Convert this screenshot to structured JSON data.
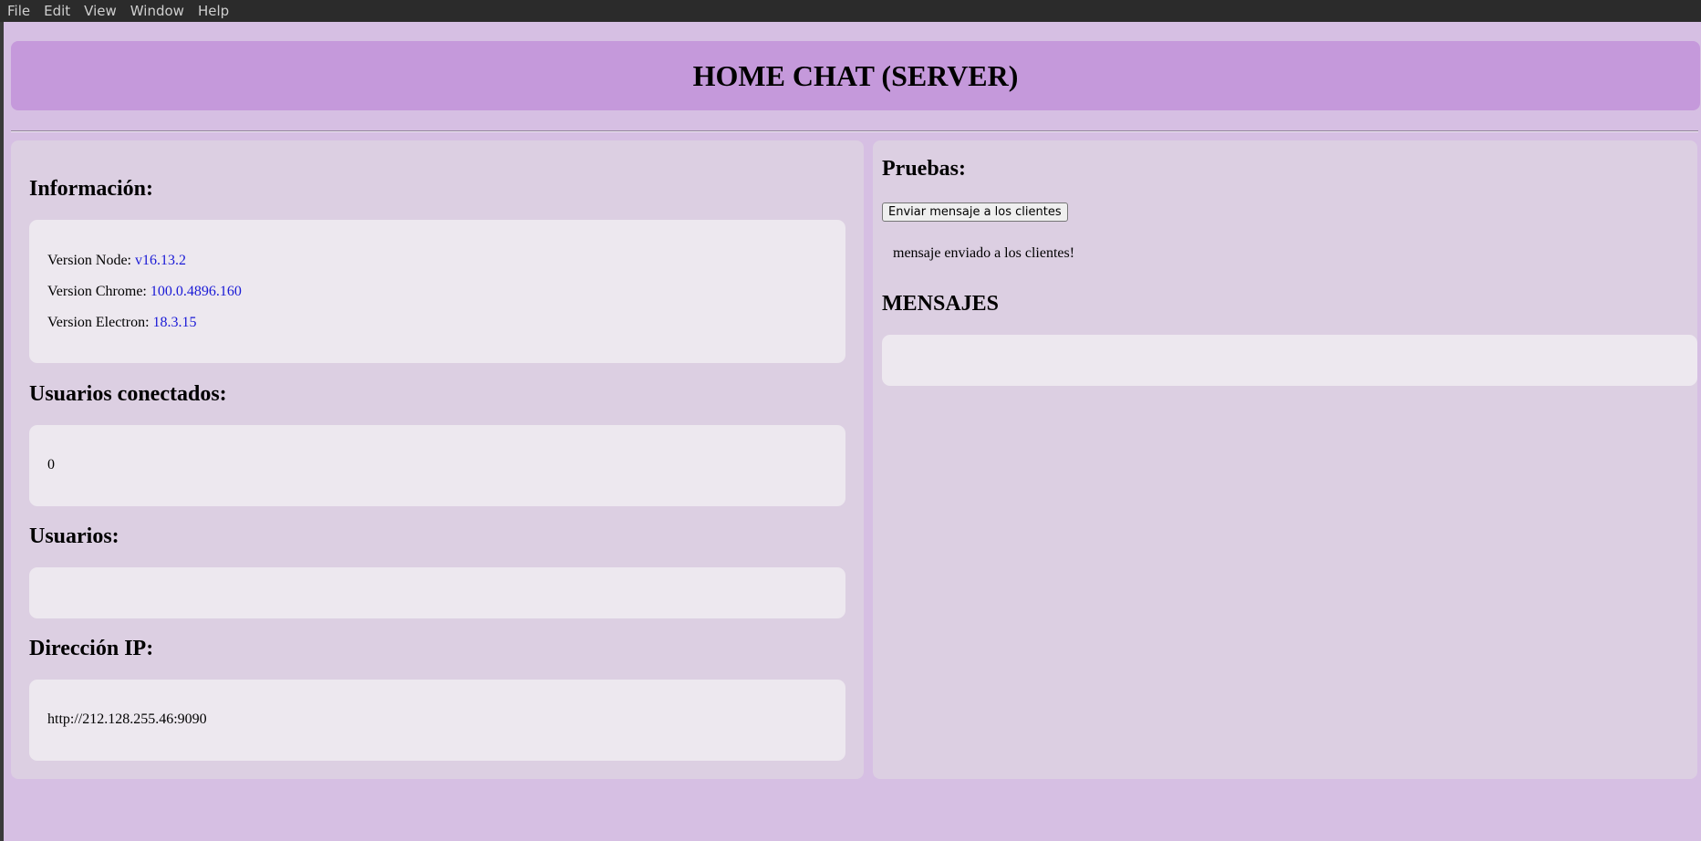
{
  "menu": [
    "File",
    "Edit",
    "View",
    "Window",
    "Help"
  ],
  "header": {
    "title": "HOME CHAT (SERVER)"
  },
  "info": {
    "heading": "Información:",
    "node_label": "Version Node:",
    "node_value": "v16.13.2",
    "chrome_label": "Version Chrome:",
    "chrome_value": "100.0.4896.160",
    "electron_label": "Version Electron:",
    "electron_value": "18.3.15"
  },
  "connected": {
    "heading": "Usuarios conectados:",
    "value": "0"
  },
  "users": {
    "heading": "Usuarios:"
  },
  "ip": {
    "heading": "Dirección IP:",
    "value": "http://212.128.255.46:9090"
  },
  "tests": {
    "heading": "Pruebas:",
    "button_label": "Enviar mensaje a los clientes",
    "status": "mensaje enviado a los clientes!"
  },
  "messages": {
    "heading": "MENSAJES"
  },
  "colors": {
    "background": "#d6bfe3",
    "header": "#c599db",
    "panel": "#dccfe2",
    "box": "#ede8ef",
    "value_text": "#1a1ad6"
  }
}
